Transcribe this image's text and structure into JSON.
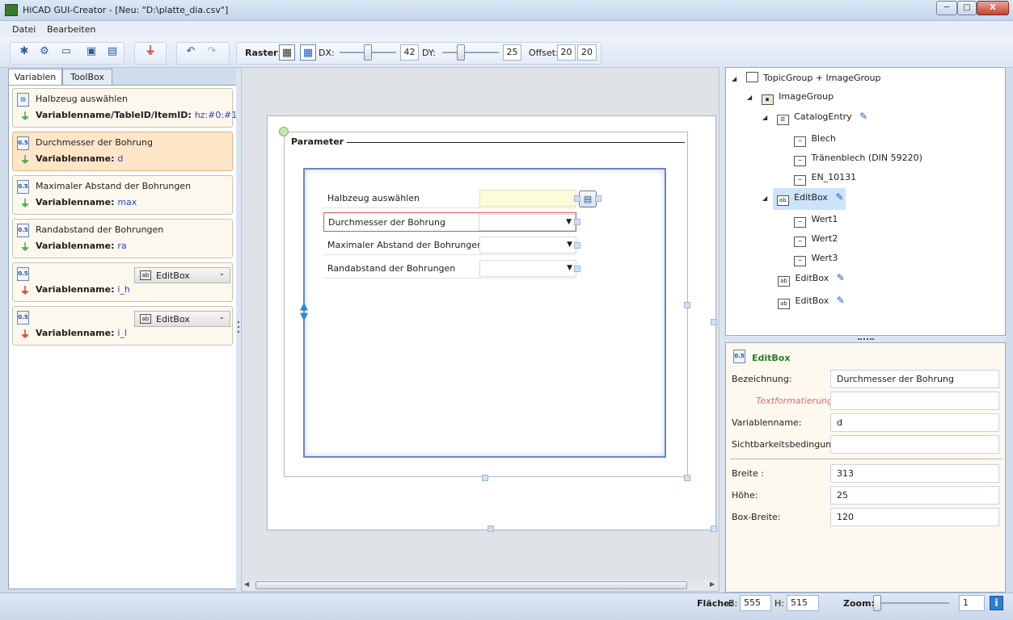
{
  "window": {
    "title": "HiCAD GUI-Creator - [Neu: \"D:\\platte_dia.csv\"]",
    "min": "─",
    "max": "□",
    "close": "X"
  },
  "menu": {
    "file": "Datei",
    "edit": "Bearbeiten"
  },
  "toolbar": {
    "raster_label": "Raster:",
    "dx_label": "DX:",
    "dx_value": "42",
    "dy_label": "DY:",
    "dy_value": "25",
    "offset_label": "Offset:",
    "offset_x": "20",
    "offset_y": "20",
    "dx_slider_level": 0.5,
    "dy_slider_level": 0.3
  },
  "left_tabs": {
    "variables": "Variablen",
    "toolbox": "ToolBox"
  },
  "variables": [
    {
      "title": "Halbzeug auswählen",
      "key_label": "Variablenname/TableID/ItemID:",
      "value": "hz:#0:#1",
      "plug": "green",
      "icon": "table-icon"
    },
    {
      "title": "Durchmesser der Bohrung",
      "key_label": "Variablenname:",
      "value": "d",
      "plug": "green",
      "icon": "number-icon"
    },
    {
      "title": "Maximaler Abstand der Bohrungen",
      "key_label": "Variablenname:",
      "value": "max",
      "plug": "green",
      "icon": "number-icon"
    },
    {
      "title": "Randabstand der Bohrungen",
      "key_label": "Variablenname:",
      "value": "ra",
      "plug": "green",
      "icon": "number-icon"
    },
    {
      "title": "",
      "key_label": "Variablenname:",
      "value": "i_h",
      "plug": "red",
      "icon": "number-icon",
      "combo": "EditBox"
    },
    {
      "title": "",
      "key_label": "Variablenname:",
      "value": "i_l",
      "plug": "red",
      "icon": "number-icon",
      "combo": "EditBox"
    }
  ],
  "number_icon_text": "0.5",
  "form": {
    "group_title": "Parameter",
    "rows": [
      {
        "label": "Halbzeug auswählen"
      },
      {
        "label": "Durchmesser der Bohrung"
      },
      {
        "label": "Maximaler Abstand der Bohrungen"
      },
      {
        "label": "Randabstand der Bohrungen"
      }
    ]
  },
  "tree": {
    "items": [
      {
        "label": "TopicGroup + ImageGroup",
        "level": 0
      },
      {
        "label": "ImageGroup",
        "level": 1
      },
      {
        "label": "CatalogEntry",
        "level": 2
      },
      {
        "label": "Blech",
        "level": 3
      },
      {
        "label": "Tränenblech (DIN 59220)",
        "level": 3
      },
      {
        "label": "EN_10131",
        "level": 3
      },
      {
        "label": "EditBox",
        "level": 2
      },
      {
        "label": "Wert1",
        "level": 3
      },
      {
        "label": "Wert2",
        "level": 3
      },
      {
        "label": "Wert3",
        "level": 3
      },
      {
        "label": "EditBox",
        "level": 2
      },
      {
        "label": "EditBox",
        "level": 2
      }
    ]
  },
  "properties": {
    "header": "EditBox",
    "fields": [
      {
        "label": "Bezeichnung:",
        "value": "Durchmesser der Bohrung"
      },
      {
        "label": "Textformatierung:",
        "value": ""
      },
      {
        "label": "Variablenname:",
        "value": "d"
      },
      {
        "label": "Sichtbarkeitsbedingung:",
        "value": ""
      },
      {
        "label": "Breite :",
        "value": "313"
      },
      {
        "label": "Höhe:",
        "value": "25"
      },
      {
        "label": "Box-Breite:",
        "value": "120"
      }
    ]
  },
  "status": {
    "area_label": "Fläche:",
    "b_label": "B:",
    "b_value": "555",
    "h_label": "H:",
    "h_value": "515",
    "zoom_label": "Zoom:",
    "zoom_value": "1",
    "info_icon_text": "i"
  },
  "colors": {
    "accent": "#2b3fc7",
    "plug_green": "#2ea12e",
    "plug_red": "#d22a2a",
    "selected_card": "#fde6c8",
    "tree_selection": "#cde3fa"
  }
}
